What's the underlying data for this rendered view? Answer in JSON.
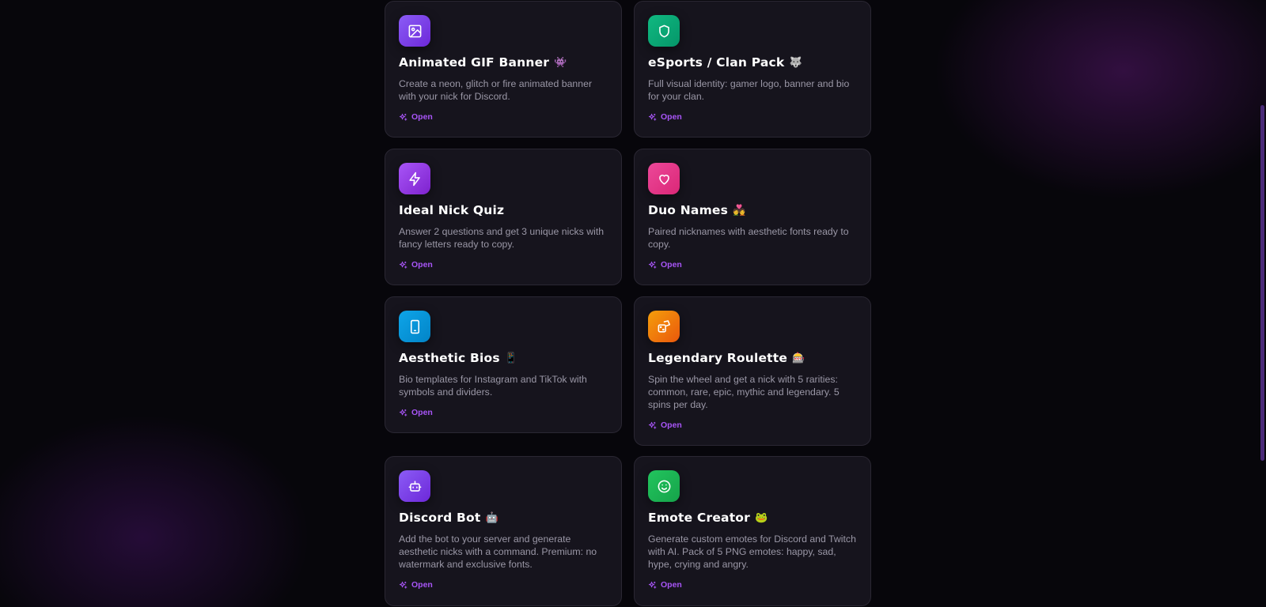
{
  "cards": [
    {
      "title": "Animated GIF Banner",
      "emoji": "👾",
      "description": "Create a neon, glitch or fire animated banner with your nick for Discord.",
      "open_label": "Open",
      "icon": "image-icon",
      "color_from": "#8b5cf6",
      "color_to": "#6d28d9"
    },
    {
      "title": "eSports / Clan Pack",
      "emoji": "🐺",
      "description": "Full visual identity: gamer logo, banner and bio for your clan.",
      "open_label": "Open",
      "icon": "shield-icon",
      "color_from": "#10b981",
      "color_to": "#059669"
    },
    {
      "title": "Ideal Nick Quiz",
      "emoji": "",
      "description": "Answer 2 questions and get 3 unique nicks with fancy letters ready to copy.",
      "open_label": "Open",
      "icon": "lightning-icon",
      "color_from": "#a855f7",
      "color_to": "#7e22ce"
    },
    {
      "title": "Duo Names",
      "emoji": "💑",
      "description": "Paired nicknames with aesthetic fonts ready to copy.",
      "open_label": "Open",
      "icon": "heart-icon",
      "color_from": "#ec4899",
      "color_to": "#db2777"
    },
    {
      "title": "Aesthetic Bios",
      "emoji": "📱",
      "description": "Bio templates for Instagram and TikTok with symbols and dividers.",
      "open_label": "Open",
      "icon": "phone-icon",
      "color_from": "#0ea5e9",
      "color_to": "#0284c7"
    },
    {
      "title": "Legendary Roulette",
      "emoji": "🎰",
      "description": "Spin the wheel and get a nick with 5 rarities: common, rare, epic, mythic and legendary. 5 spins per day.",
      "open_label": "Open",
      "icon": "dice-icon",
      "color_from": "#f59e0b",
      "color_to": "#ea580c"
    },
    {
      "title": "Discord Bot",
      "emoji": "🤖",
      "description": "Add the bot to your server and generate aesthetic nicks with a command. Premium: no watermark and exclusive fonts.",
      "open_label": "Open",
      "icon": "robot-icon",
      "color_from": "#8b5cf6",
      "color_to": "#6d28d9"
    },
    {
      "title": "Emote Creator",
      "emoji": "🐸",
      "description": "Generate custom emotes for Discord and Twitch with AI. Pack of 5 PNG emotes: happy, sad, hype, crying and angry.",
      "open_label": "Open",
      "icon": "smile-icon",
      "color_from": "#22c55e",
      "color_to": "#16a34a"
    }
  ]
}
